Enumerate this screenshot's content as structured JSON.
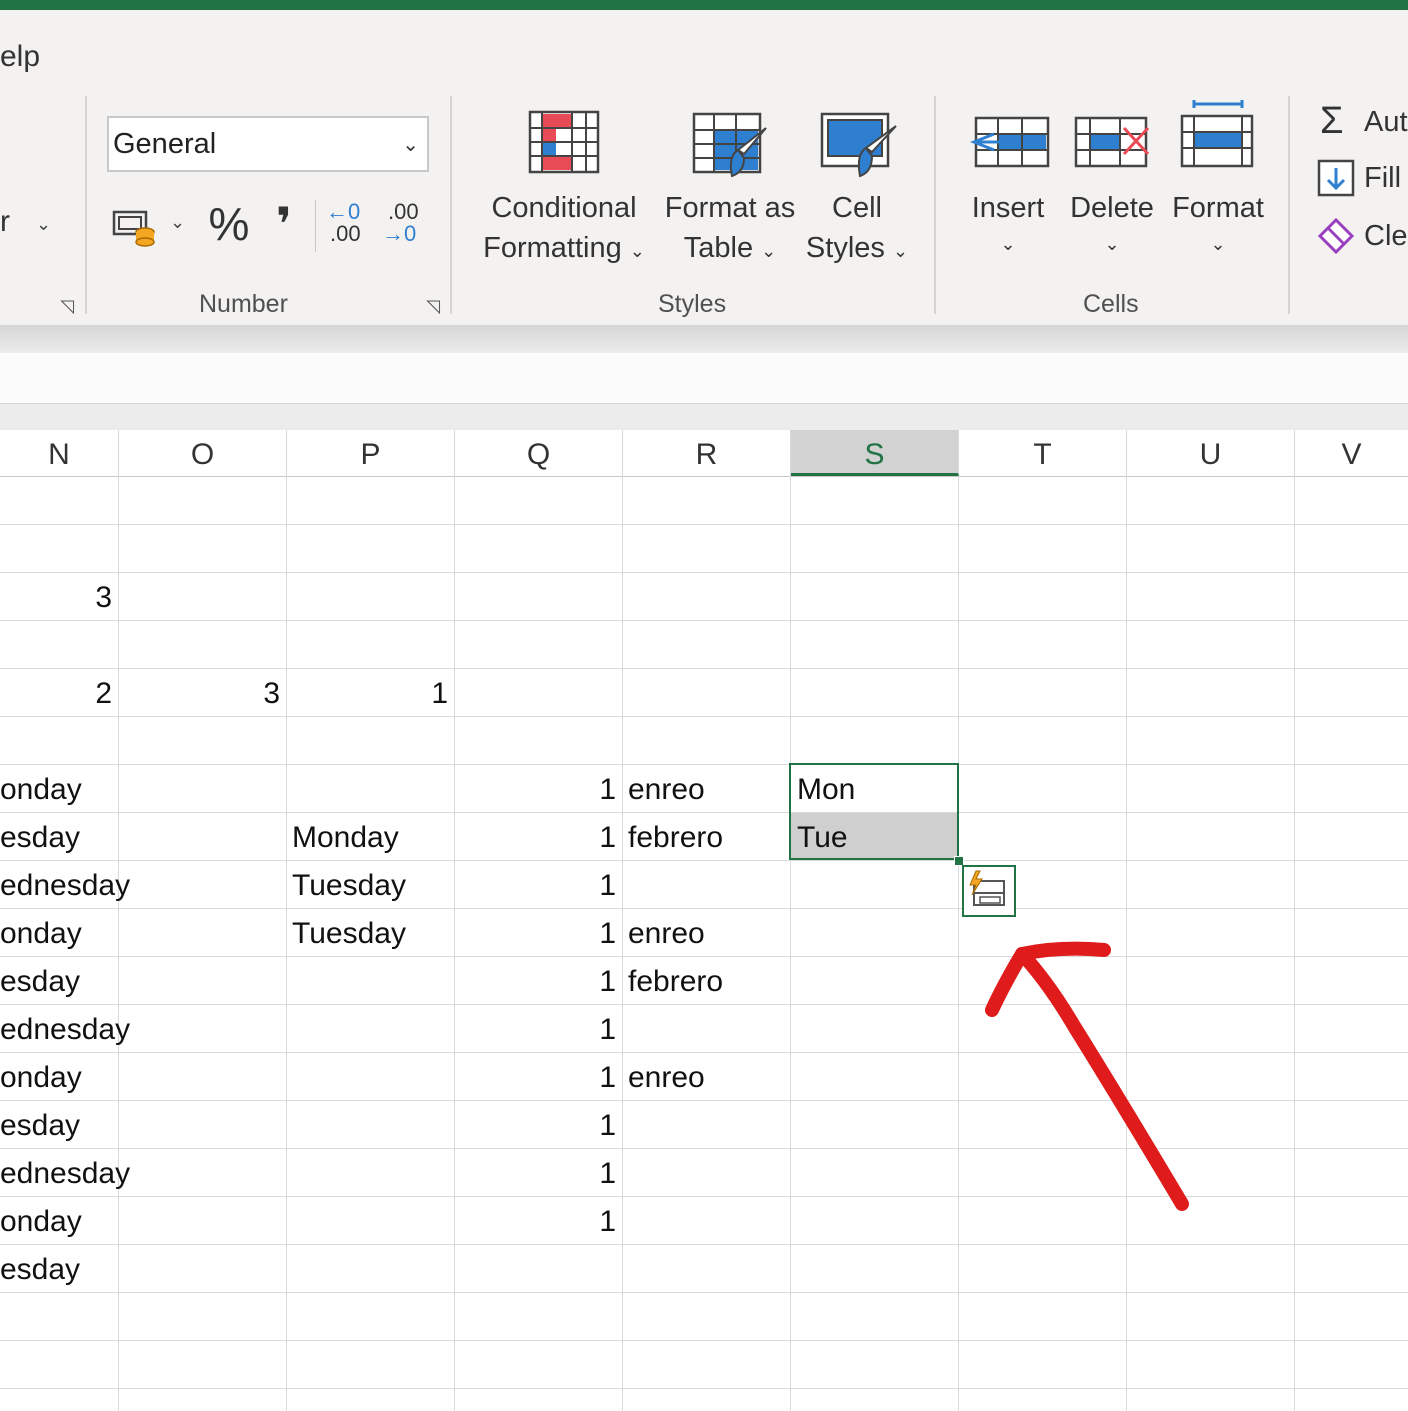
{
  "menu": {
    "help_partial": "elp"
  },
  "ribbon": {
    "alignment_partial": {
      "label_fragment": "r"
    },
    "number": {
      "group_label": "Number",
      "format_value": "General",
      "percent_symbol": "%",
      "comma_symbol": "❜",
      "increase_decimal_top": "←0",
      "increase_decimal_bottom": ".00",
      "decrease_decimal_top": ".00",
      "decrease_decimal_bottom": "→0"
    },
    "styles": {
      "group_label": "Styles",
      "conditional_formatting_line1": "Conditional",
      "conditional_formatting_line2": "Formatting",
      "format_as_table_line1": "Format as",
      "format_as_table_line2": "Table",
      "cell_styles_line1": "Cell",
      "cell_styles_line2": "Styles"
    },
    "cells": {
      "group_label": "Cells",
      "insert": "Insert",
      "delete": "Delete",
      "format": "Format"
    },
    "editing": {
      "autosum": "Aut",
      "autosum_symbol": "Σ",
      "fill": "Fill",
      "clear": "Cle"
    }
  },
  "grid": {
    "columns": [
      "N",
      "O",
      "P",
      "Q",
      "R",
      "S",
      "T",
      "U",
      "V"
    ],
    "selected_column": "S",
    "cells": {
      "N3": "3",
      "N5": "2",
      "O5": "3",
      "P5": "1",
      "N7": "onday",
      "Q7": "1",
      "R7": "enreo",
      "S7": "Mon",
      "N8": "esday",
      "P8": "Monday",
      "Q8": "1",
      "R8": "febrero",
      "S8": "Tue",
      "N9": "ednesday",
      "P9": "Tuesday",
      "Q9": "1",
      "N10": "onday",
      "P10": "Tuesday",
      "Q10": "1",
      "R10": "enreo",
      "N11": "esday",
      "Q11": "1",
      "R11": "febrero",
      "N12": "ednesday",
      "Q12": "1",
      "N13": "onday",
      "Q13": "1",
      "R13": "enreo",
      "N14": "esday",
      "Q14": "1",
      "N15": "ednesday",
      "Q15": "1",
      "N16": "onday",
      "Q16": "1",
      "N17": "esday"
    }
  },
  "colors": {
    "accent": "#217346",
    "annotation": "#e01b1b",
    "icon_blue": "#2f7fd1",
    "icon_red": "#e84b55"
  }
}
